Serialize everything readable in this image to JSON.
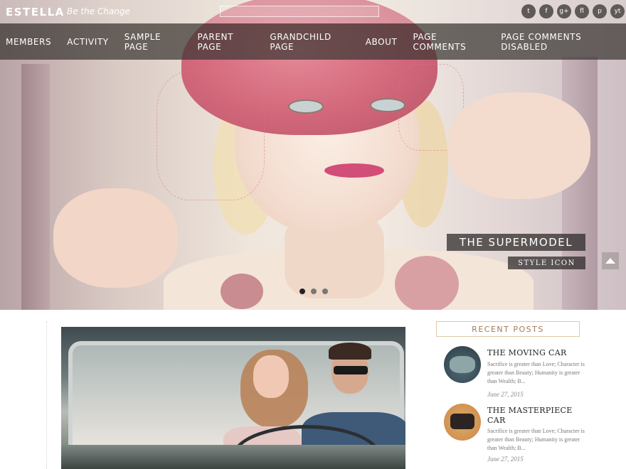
{
  "site": {
    "title": "ESTELLA",
    "tagline": "Be the Change"
  },
  "search": {
    "placeholder": ""
  },
  "social": [
    "t",
    "f",
    "g+",
    "fl",
    "p",
    "yt"
  ],
  "nav": {
    "items": [
      "MEMBERS",
      "ACTIVITY",
      "SAMPLE PAGE",
      "PARENT PAGE",
      "GRANDCHILD PAGE",
      "ABOUT",
      "PAGE COMMENTS",
      "PAGE COMMENTS DISABLED"
    ]
  },
  "slider": {
    "caption_title": "THE SUPERMODEL",
    "caption_subtitle": "STYLE ICON",
    "active_slide": 1,
    "slide_count": 3
  },
  "sidebar": {
    "heading": "RECENT POSTS",
    "posts": [
      {
        "title": "THE MOVING CAR",
        "excerpt": "Sacrifice is greater than Love; Character is greater than Beauty; Humanity is greater than Wealth; B...",
        "date": "June 27, 2015"
      },
      {
        "title": "THE MASTERPIECE CAR",
        "excerpt": "Sacrifice is greater than Love; Character is greater than Beauty; Humanity is greater than Wealth; B...",
        "date": "June 27, 2015"
      }
    ]
  },
  "colors": {
    "nav_bg": "#3a3632",
    "accent": "#a27a55",
    "heading_border": "#e0c9a8"
  }
}
